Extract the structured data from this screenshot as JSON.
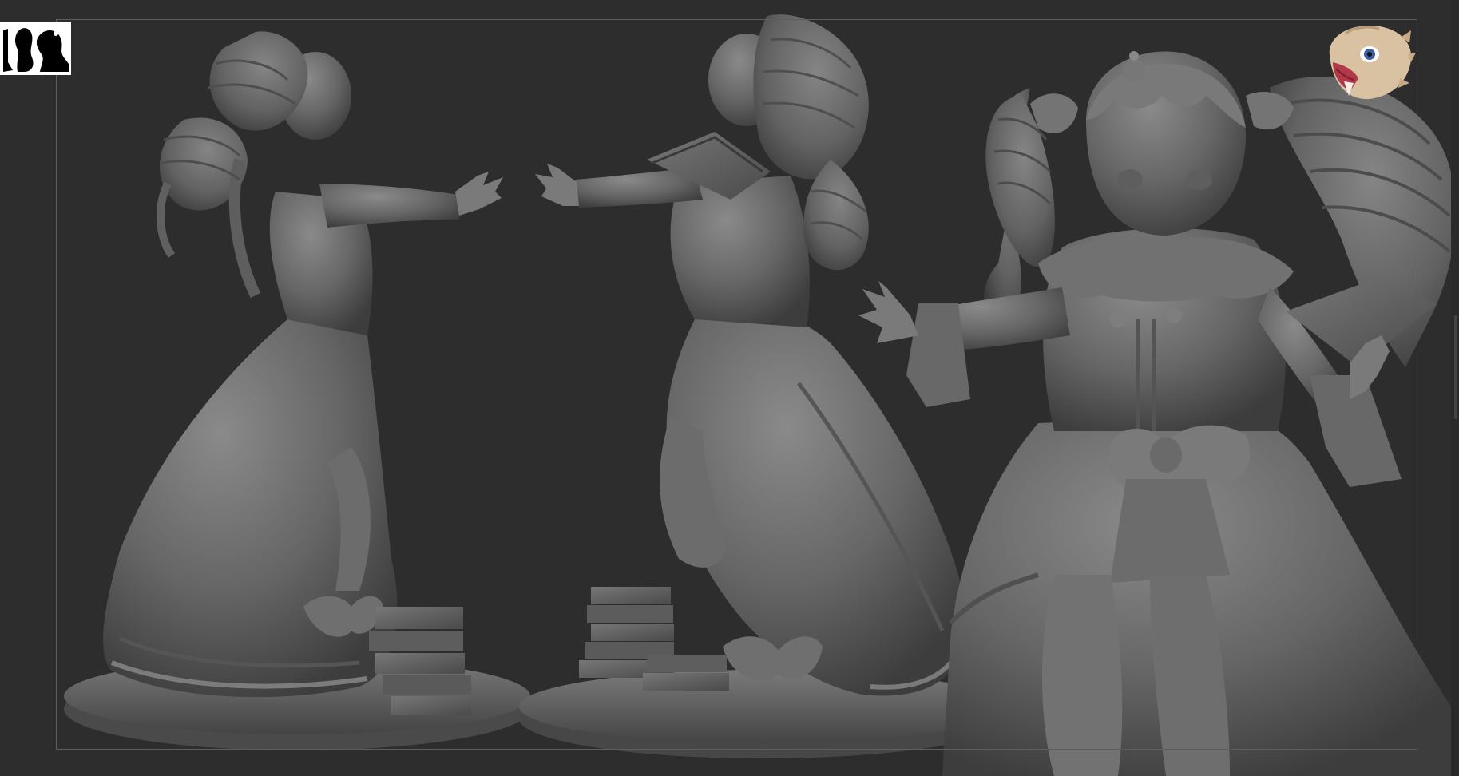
{
  "app": {
    "canvas_background": "#2d2d2d",
    "frame_color": "#5e5e5e",
    "model_color": "#6e6e6e"
  },
  "scene": {
    "views": [
      "side-view-figure",
      "back-view-figure",
      "front-view-figure"
    ],
    "icons": [
      "silhouette-thumbnail-icon",
      "mascot-avatar-icon"
    ]
  }
}
